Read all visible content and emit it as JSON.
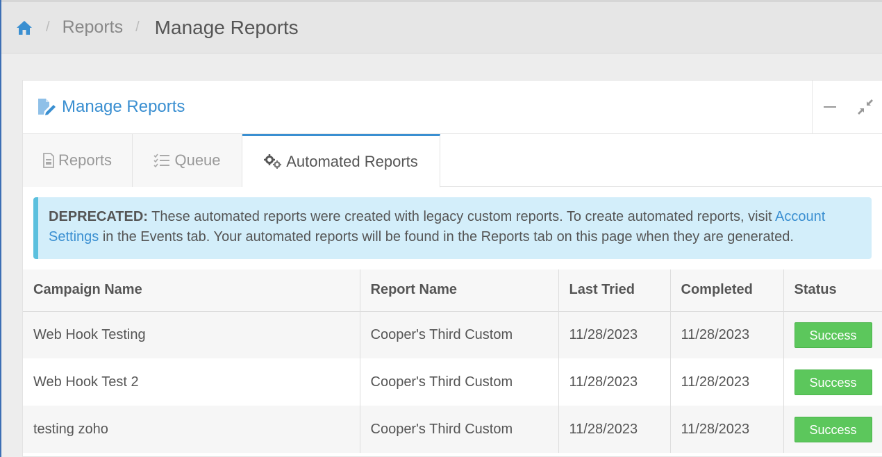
{
  "breadcrumb": {
    "home_icon": "home-icon",
    "sep": "/",
    "items": [
      "Reports"
    ],
    "current": "Manage Reports"
  },
  "portlet": {
    "title": "Manage Reports",
    "title_icon": "edit-file-icon"
  },
  "tabs": [
    {
      "label": "Reports",
      "icon": "document-icon"
    },
    {
      "label": "Queue",
      "icon": "checklist-icon"
    },
    {
      "label": "Automated Reports",
      "icon": "gears-icon",
      "active": true
    }
  ],
  "alert": {
    "strong": "DEPRECATED:",
    "text1": " These automated reports were created with legacy custom reports. To create automated reports, visit ",
    "link": "Account Settings",
    "text2": " in the Events tab. Your automated reports will be found in the Reports tab on this page when they are generated."
  },
  "table": {
    "headers": [
      "Campaign Name",
      "Report Name",
      "Last Tried",
      "Completed",
      "Status"
    ],
    "rows": [
      [
        "Web Hook Testing",
        "Cooper's Third Custom",
        "11/28/2023",
        "11/28/2023",
        "Success"
      ],
      [
        "Web Hook Test 2",
        "Cooper's Third Custom",
        "11/28/2023",
        "11/28/2023",
        "Success"
      ],
      [
        "testing zoho",
        "Cooper's Third Custom",
        "11/28/2023",
        "11/28/2023",
        "Success"
      ]
    ]
  },
  "colors": {
    "accent": "#3a8fd1",
    "success": "#5cc75c",
    "alert_bg": "#d3eefa"
  }
}
